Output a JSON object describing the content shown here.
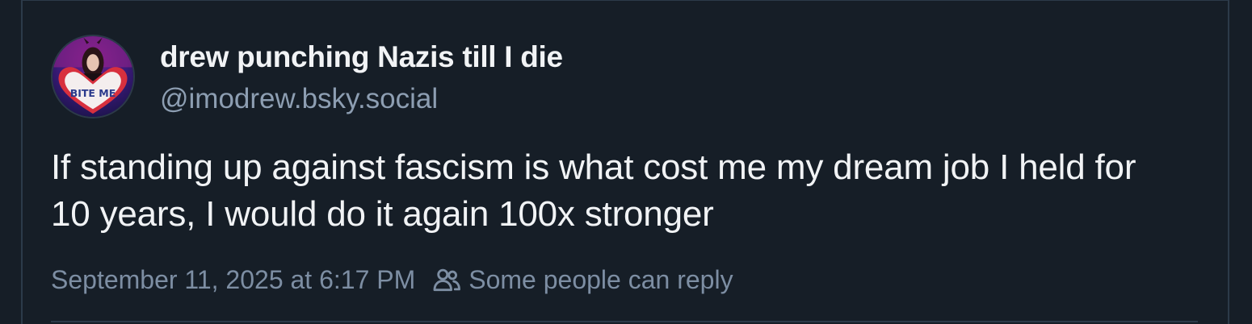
{
  "author": {
    "display_name": "drew punching Nazis till I die",
    "handle": "@imodrew.bsky.social",
    "avatar_icon": "profile-photo",
    "avatar_text": "BITE ME"
  },
  "post": {
    "text": "If standing up against fascism is what cost me my dream job I held for 10 years, I would do it again 100x stronger",
    "timestamp": "September 11, 2025 at 6:17 PM",
    "reply_setting": "Some people can reply",
    "reply_icon": "people-icon"
  },
  "colors": {
    "background": "#161e27",
    "text_primary": "#f1f3f5",
    "text_secondary": "#8d9eb2",
    "border": "#2c3a49"
  }
}
